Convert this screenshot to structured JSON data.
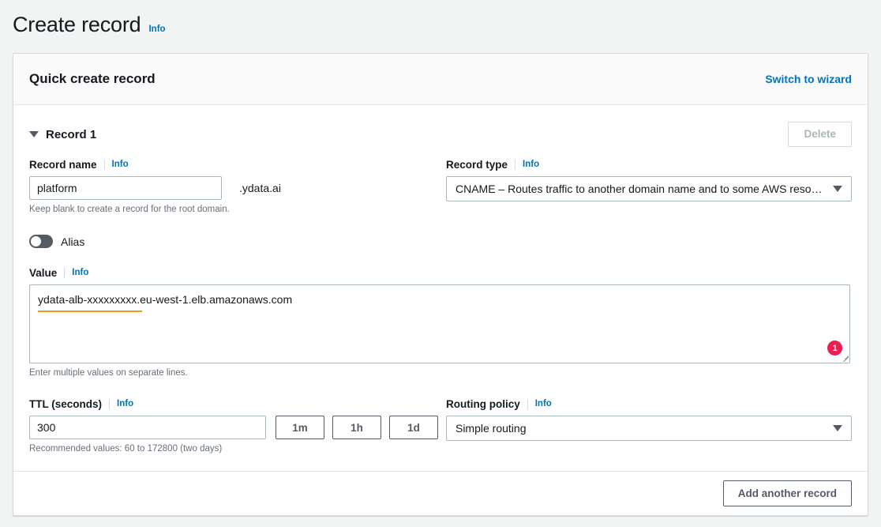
{
  "header": {
    "title": "Create record",
    "info_label": "Info"
  },
  "panel": {
    "title": "Quick create record",
    "switch_link": "Switch to wizard"
  },
  "record": {
    "caret_icon": "triangle-down-icon",
    "label": "Record 1",
    "delete_label": "Delete",
    "record_name": {
      "label": "Record name",
      "info_label": "Info",
      "value": "platform",
      "placeholder": "",
      "suffix": ".ydata.ai",
      "hint": "Keep blank to create a record for the root domain."
    },
    "record_type": {
      "label": "Record type",
      "info_label": "Info",
      "selected": "CNAME – Routes traffic to another domain name and to some AWS reso…",
      "arrow_icon": "chevron-down-icon"
    },
    "alias": {
      "label": "Alias",
      "enabled": false
    },
    "value": {
      "label": "Value",
      "info_label": "Info",
      "text": "ydata-alb-xxxxxxxxx.eu-west-1.elb.amazonaws.com",
      "placeholder": "",
      "hint": "Enter multiple values on separate lines.",
      "badge_count": "1",
      "badge_color": "#eb1f50",
      "spellcheck_color": "#eb9c26"
    },
    "ttl": {
      "label": "TTL (seconds)",
      "info_label": "Info",
      "value": "300",
      "hint": "Recommended values: 60 to 172800 (two days)",
      "quick_buttons": [
        "1m",
        "1h",
        "1d"
      ]
    },
    "routing_policy": {
      "label": "Routing policy",
      "info_label": "Info",
      "selected": "Simple routing",
      "arrow_icon": "chevron-down-icon"
    }
  },
  "footer": {
    "add_label": "Add another record"
  },
  "colors": {
    "link": "#0073bb",
    "page_bg": "#f2f3f3",
    "text": "#16191f"
  }
}
